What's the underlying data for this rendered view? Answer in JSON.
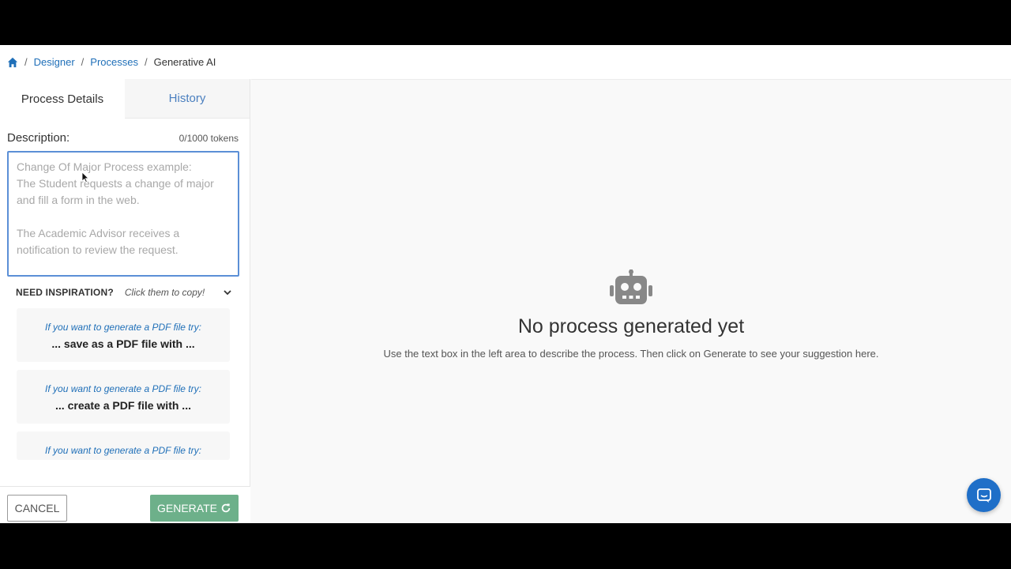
{
  "breadcrumb": {
    "items": [
      "Designer",
      "Processes"
    ],
    "current": "Generative AI",
    "separator": "/"
  },
  "tabs": [
    {
      "label": "Process Details",
      "active": true
    },
    {
      "label": "History",
      "active": false
    }
  ],
  "description": {
    "label": "Description:",
    "tokens": "0/1000 tokens",
    "placeholder": "Change Of Major Process example:\nThe Student requests a change of major and fill a form in the web.\n\nThe Academic Advisor receives a notification to review the request.",
    "value": ""
  },
  "inspiration": {
    "title": "NEED INSPIRATION?",
    "hint": "Click them to copy!",
    "cards": [
      {
        "hint": "If you want to generate a PDF file try:",
        "phrase": "... save as a PDF file with ..."
      },
      {
        "hint": "If you want to generate a PDF file try:",
        "phrase": "... create a PDF file with ..."
      },
      {
        "hint": "If you want to generate a PDF file try:",
        "phrase": ""
      }
    ],
    "dots_total": 9,
    "dots_active_index": 3
  },
  "footer": {
    "cancel_label": "CANCEL",
    "generate_label": "GENERATE"
  },
  "empty_state": {
    "title": "No process generated yet",
    "subtitle": "Use the text box in the left area to describe the process. Then click on Generate to see your suggestion here."
  },
  "colors": {
    "link": "#1f6fb8",
    "generate": "#6db08a",
    "chat": "#1f6fc8",
    "dot_active": "#1f5a96",
    "dot_inactive": "#b8d0ec"
  },
  "icons": {
    "home": "home-icon",
    "chevron": "chevron-down-icon",
    "refresh": "refresh-icon",
    "robot": "robot-icon",
    "chat": "chat-icon"
  }
}
